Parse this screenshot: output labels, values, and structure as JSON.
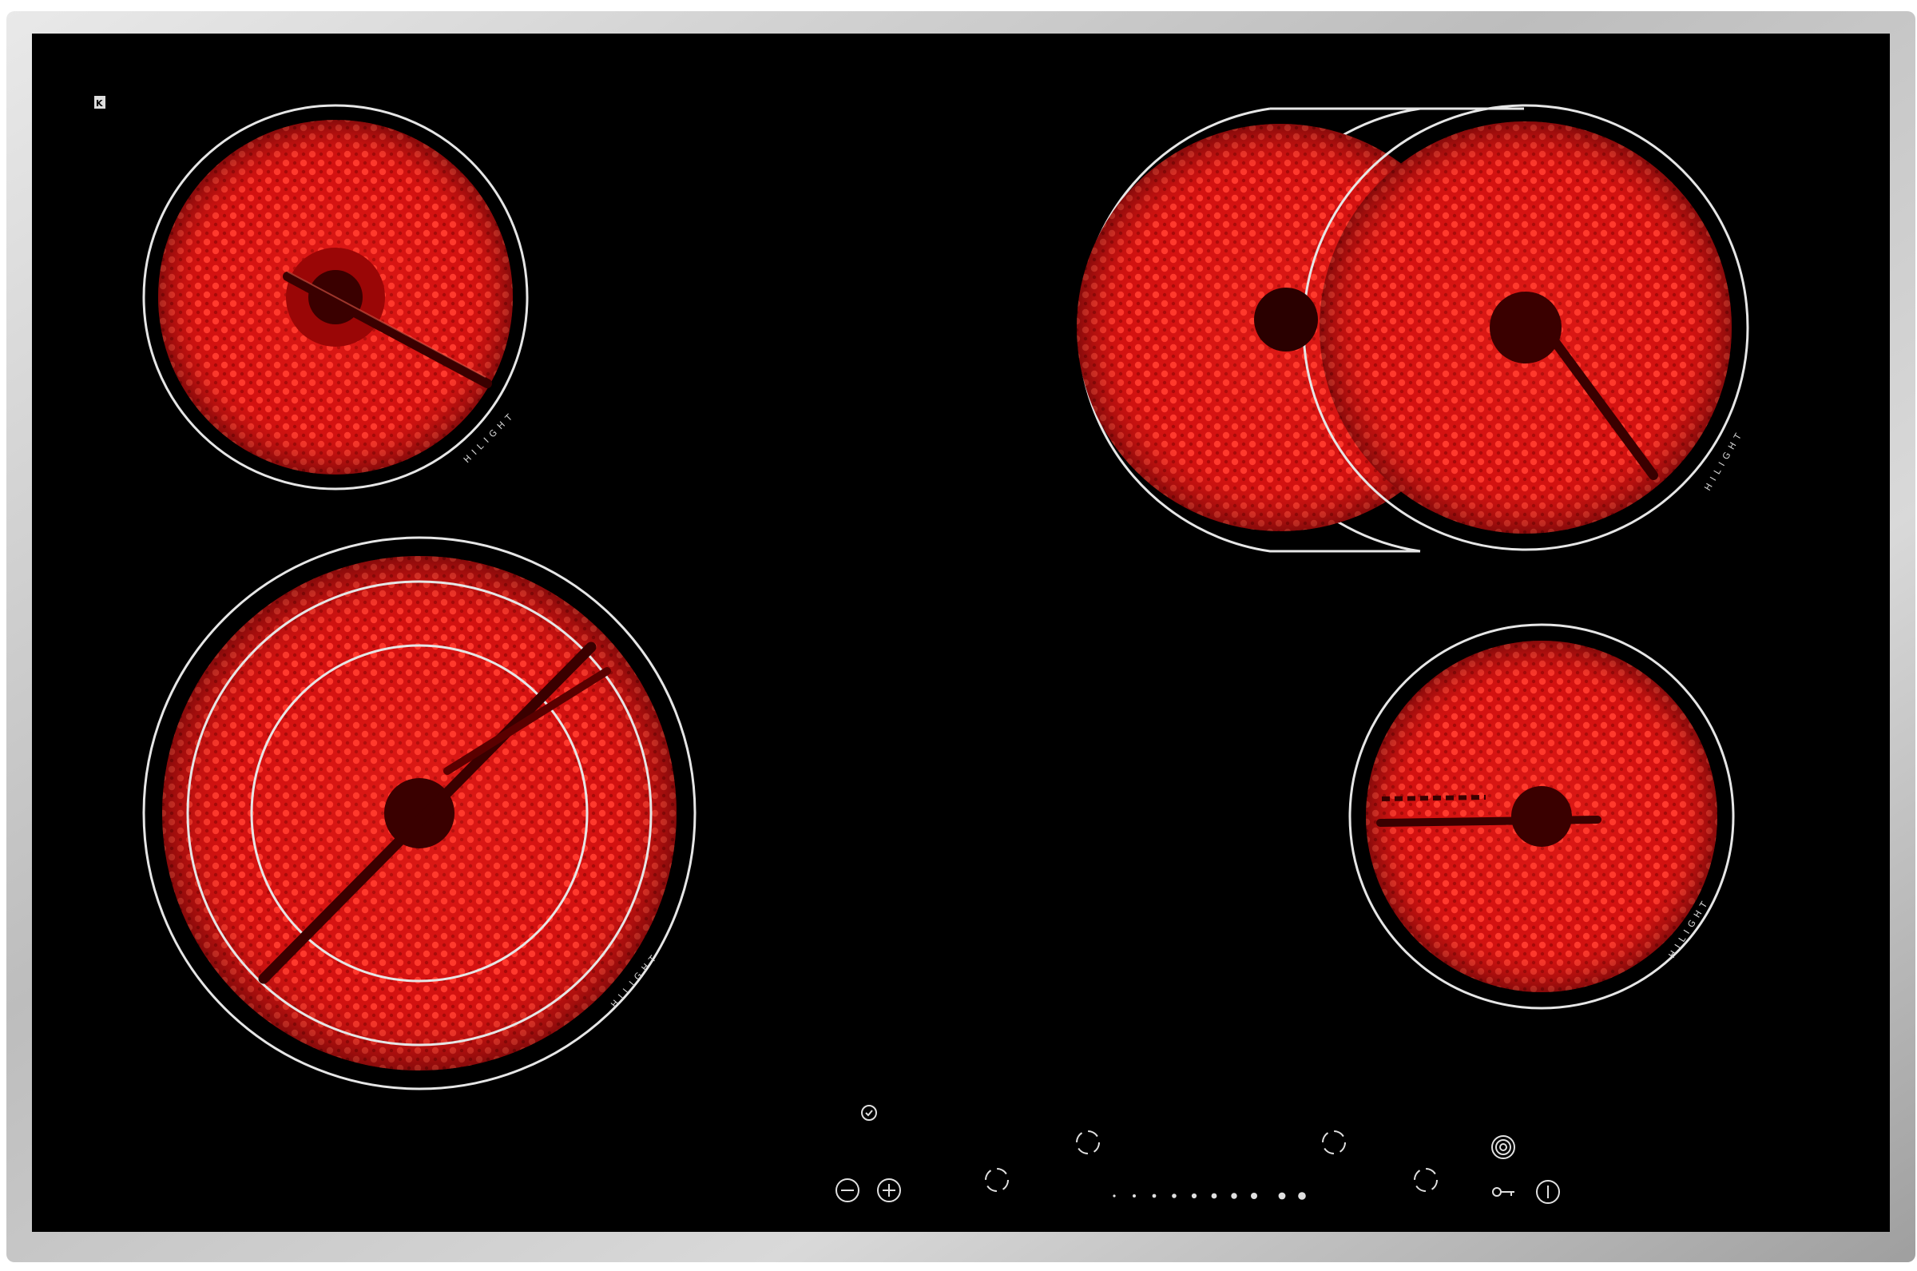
{
  "appliance": {
    "type": "ceramic-cooktop",
    "brand_mark": "K",
    "zone_label": "HILIGHT"
  },
  "colors": {
    "frame": "#c8c8c8",
    "glass": "#000000",
    "heat": "#ff1a1a",
    "heat_dark": "#7a0000",
    "ring": "#e6e6e6",
    "controls": "#e0e0e0"
  },
  "zones": [
    {
      "name": "rear-left",
      "active": true
    },
    {
      "name": "front-left-triple-ring",
      "active": true
    },
    {
      "name": "rear-right-oval-extension",
      "active": true
    },
    {
      "name": "front-right",
      "active": true
    }
  ],
  "controls": {
    "timer_icon": "clock-icon",
    "minus_icon": "minus-icon",
    "plus_icon": "plus-icon",
    "zone_selector_icon": "zone-selector-icon",
    "power_level_dots": 10,
    "multi_ring_icon": "multi-ring-icon",
    "lock_icon": "key-lock-icon",
    "power_icon": "power-icon"
  }
}
